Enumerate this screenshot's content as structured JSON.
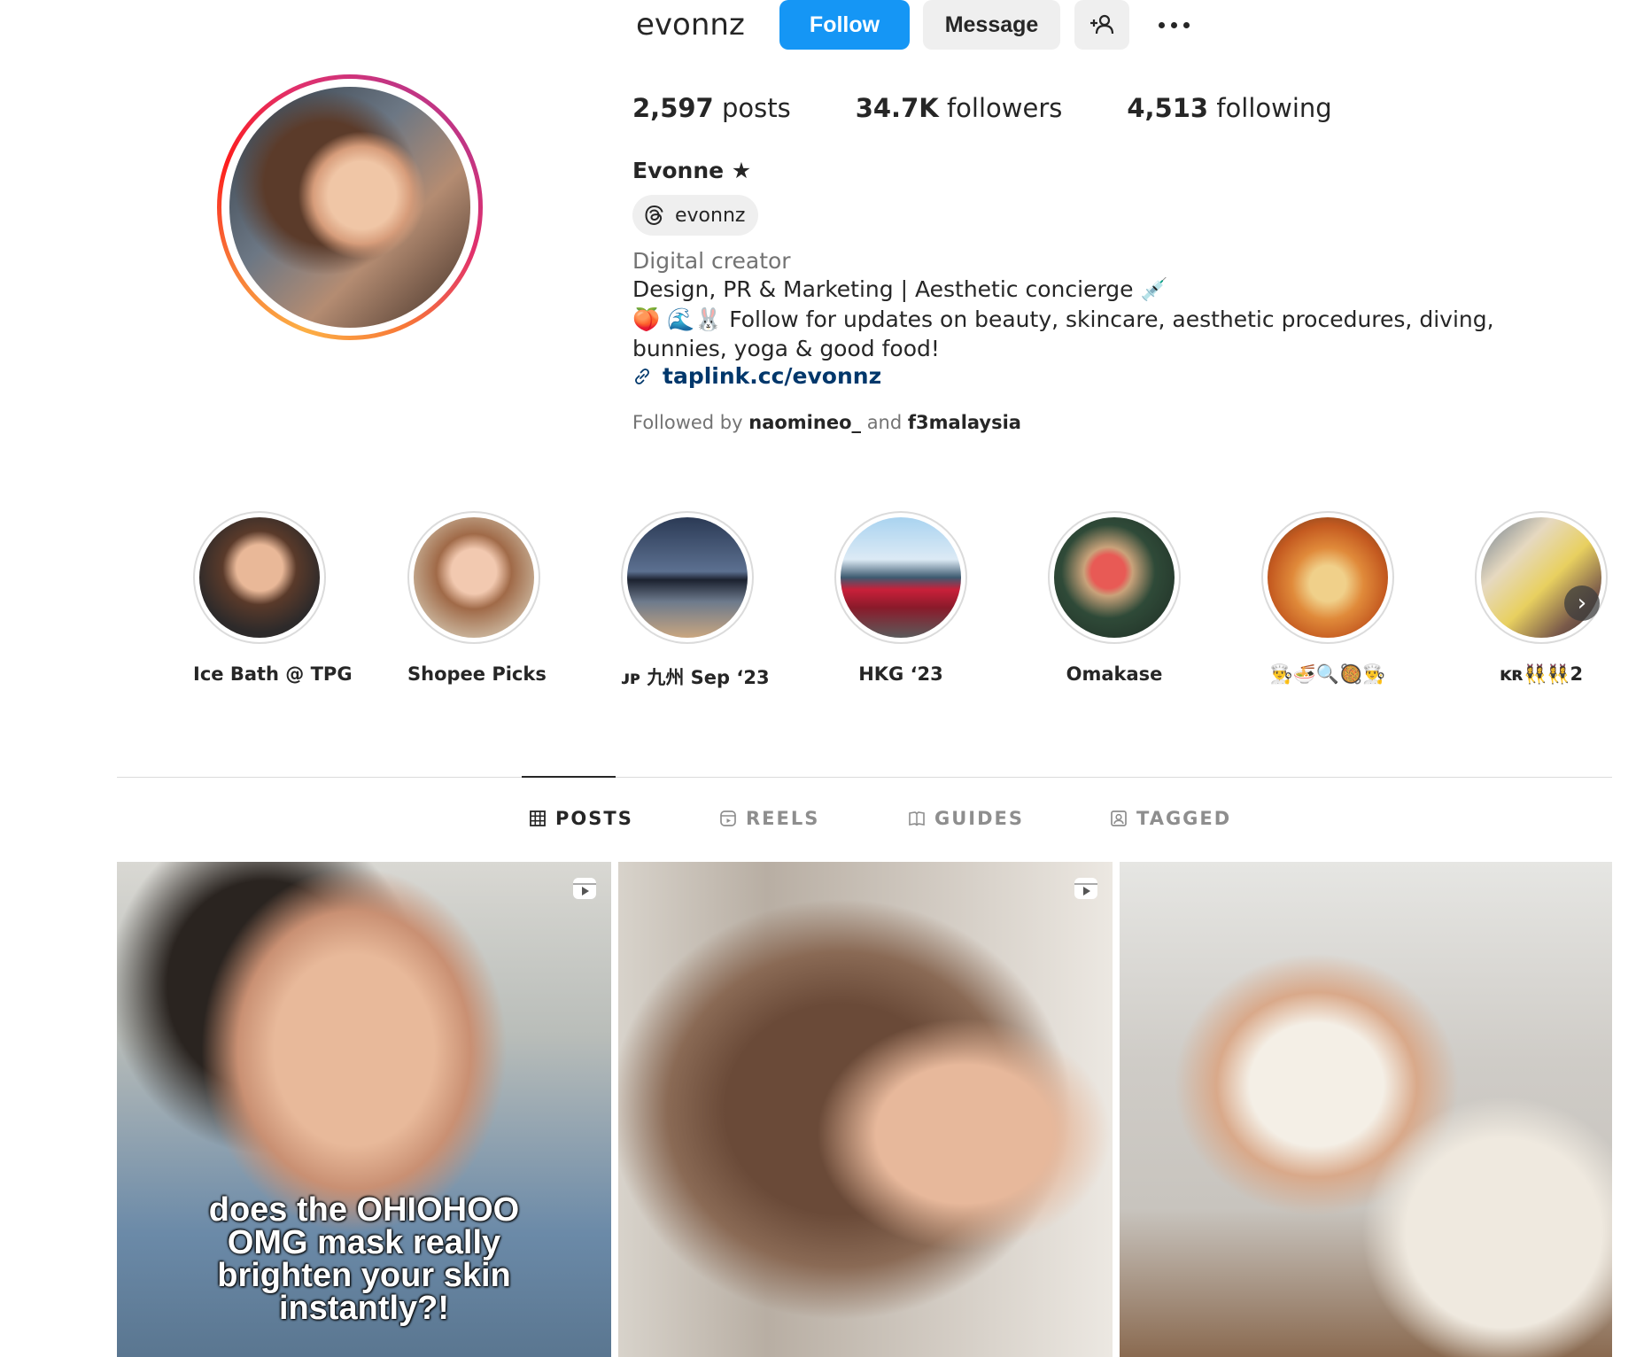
{
  "header": {
    "username": "evonnz",
    "follow_label": "Follow",
    "message_label": "Message"
  },
  "stats": {
    "posts_count": "2,597",
    "posts_label": "posts",
    "followers_count": "34.7K",
    "followers_label": "followers",
    "following_count": "4,513",
    "following_label": "following"
  },
  "profile": {
    "full_name": "Evonne ★",
    "threads_handle": "evonnz",
    "category": "Digital creator",
    "bio_line1": "Design, PR & Marketing | Aesthetic concierge 💉",
    "bio_line2": "🍑 🌊🐰 Follow for updates on beauty, skincare, aesthetic procedures, diving, bunnies, yoga & good food!",
    "link": "taplink.cc/evonnz",
    "followed_by_prefix": "Followed by",
    "followed_by_user1": "naomineo_",
    "followed_by_and": "and",
    "followed_by_user2": "f3malaysia"
  },
  "highlights": [
    {
      "label": "Ice Bath @ TPG"
    },
    {
      "label": "Shopee Picks"
    },
    {
      "label": "ᴊᴘ 九州 Sep ‘23"
    },
    {
      "label": "HKG ‘23"
    },
    {
      "label": "Omakase"
    },
    {
      "label": "👨‍🍳🍜🔍🥘👨‍🍳"
    },
    {
      "label": "ᴋʀ👯‍♀️👯‍♀️2"
    }
  ],
  "tabs": [
    {
      "label": "POSTS",
      "active": true
    },
    {
      "label": "REELS",
      "active": false
    },
    {
      "label": "GUIDES",
      "active": false
    },
    {
      "label": "TAGGED",
      "active": false
    }
  ],
  "posts": [
    {
      "caption": "does the OHIOHOO OMG mask really brighten your skin instantly?!",
      "is_reel": true
    },
    {
      "caption": "",
      "is_reel": true
    },
    {
      "caption": "",
      "is_reel": false
    }
  ],
  "colors": {
    "follow_button": "#1596f5",
    "link": "#00376b",
    "secondary_text": "#737373"
  }
}
